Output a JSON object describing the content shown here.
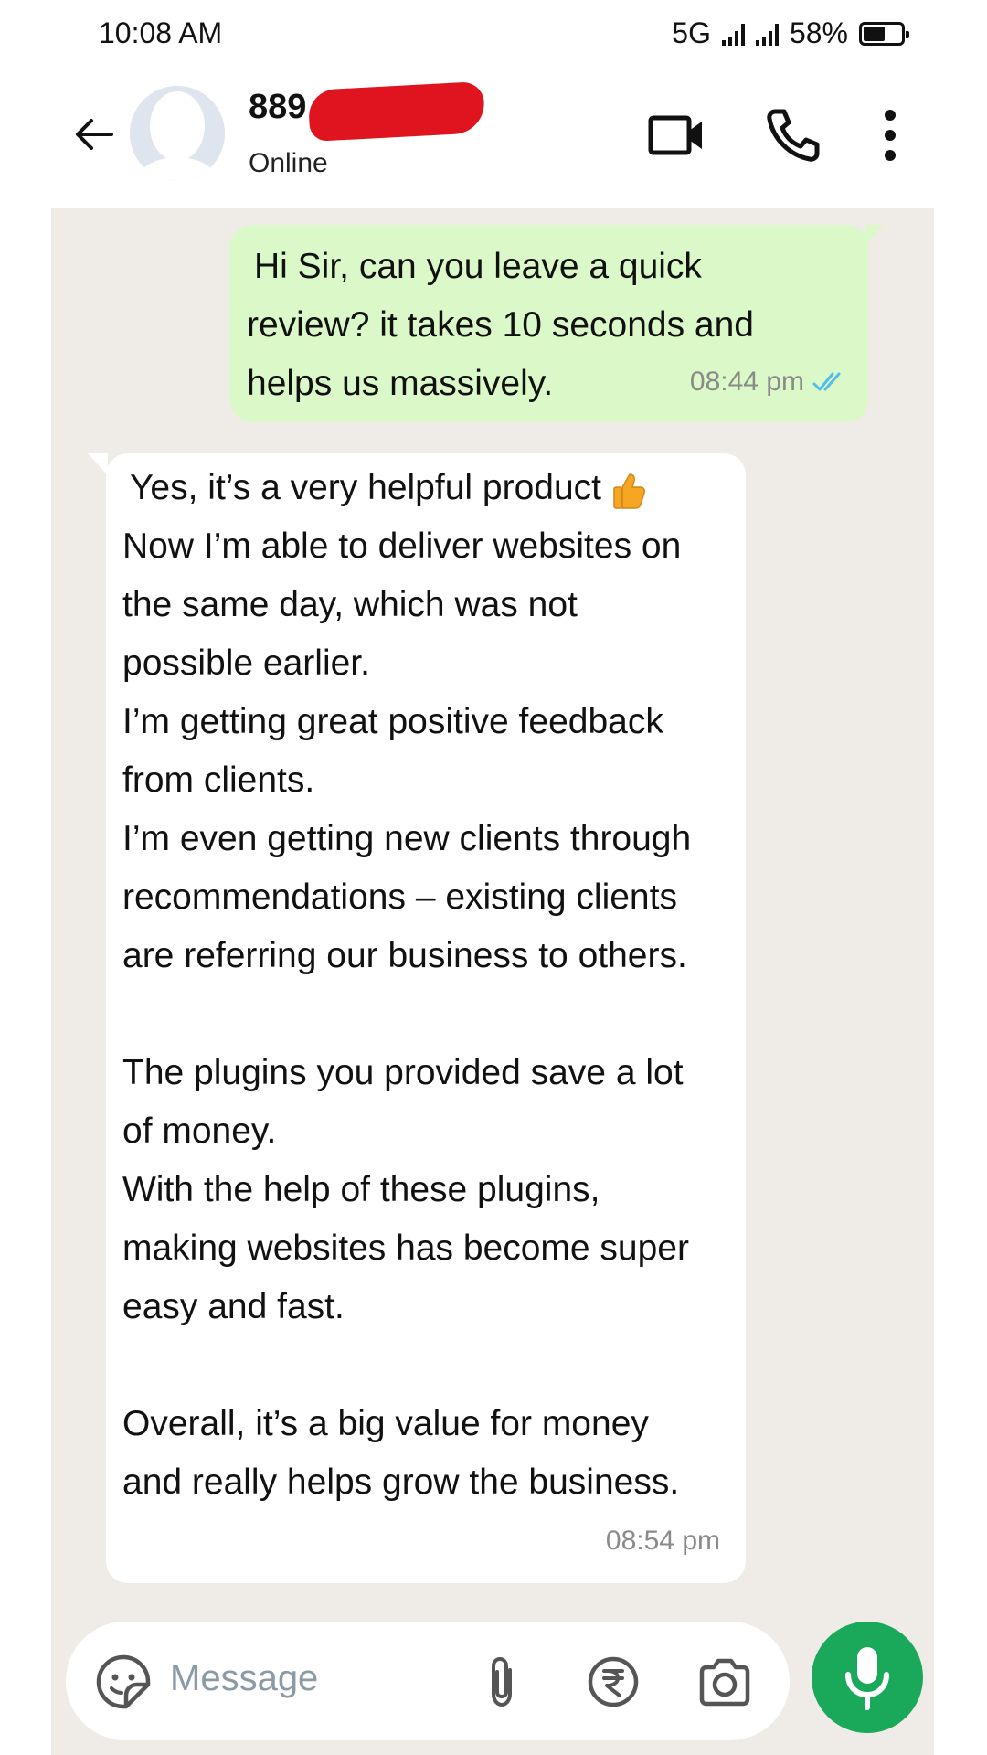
{
  "status_bar": {
    "time": "10:08 AM",
    "network": "5G",
    "battery": "58%",
    "battery_level": 0.58
  },
  "header": {
    "contact_name_visible": "889",
    "contact_status": "Online",
    "icons": [
      "back-arrow-icon",
      "video-call-icon",
      "phone-icon",
      "more-options-icon"
    ]
  },
  "messages": [
    {
      "direction": "outgoing",
      "lines": [
        "Hi Sir, can you leave a quick",
        "review? it takes 10 seconds and",
        "helps us massively."
      ],
      "time": "08:44 pm",
      "status": "read"
    },
    {
      "direction": "incoming",
      "lines": [
        "Yes, it’s a very helpful product",
        "Now I’m able to deliver websites on",
        "the same day, which was not",
        "possible earlier.",
        "I’m getting great positive feedback",
        "from clients.",
        "I’m even getting new clients through",
        "recommendations – existing clients",
        "are referring our business to others.",
        "",
        "The plugins you provided save a lot",
        "of money.",
        "With the help of these plugins,",
        "making websites has become super",
        "easy and fast.",
        "",
        "Overall, it’s a big value for money",
        "and really helps grow the business."
      ],
      "first_line_emoji": "thumbs-up-icon",
      "time": "08:54 pm"
    }
  ],
  "composer": {
    "placeholder": "Message",
    "icons": [
      "sticker-icon",
      "attach-icon",
      "payment-rupee-icon",
      "camera-icon",
      "mic-icon"
    ]
  },
  "colors": {
    "chat_bg": "#efebe6",
    "outgoing_bubble": "#dbf8c9",
    "incoming_bubble": "#ffffff",
    "read_ticks": "#53bdeb",
    "mic_button": "#1aa85a"
  }
}
